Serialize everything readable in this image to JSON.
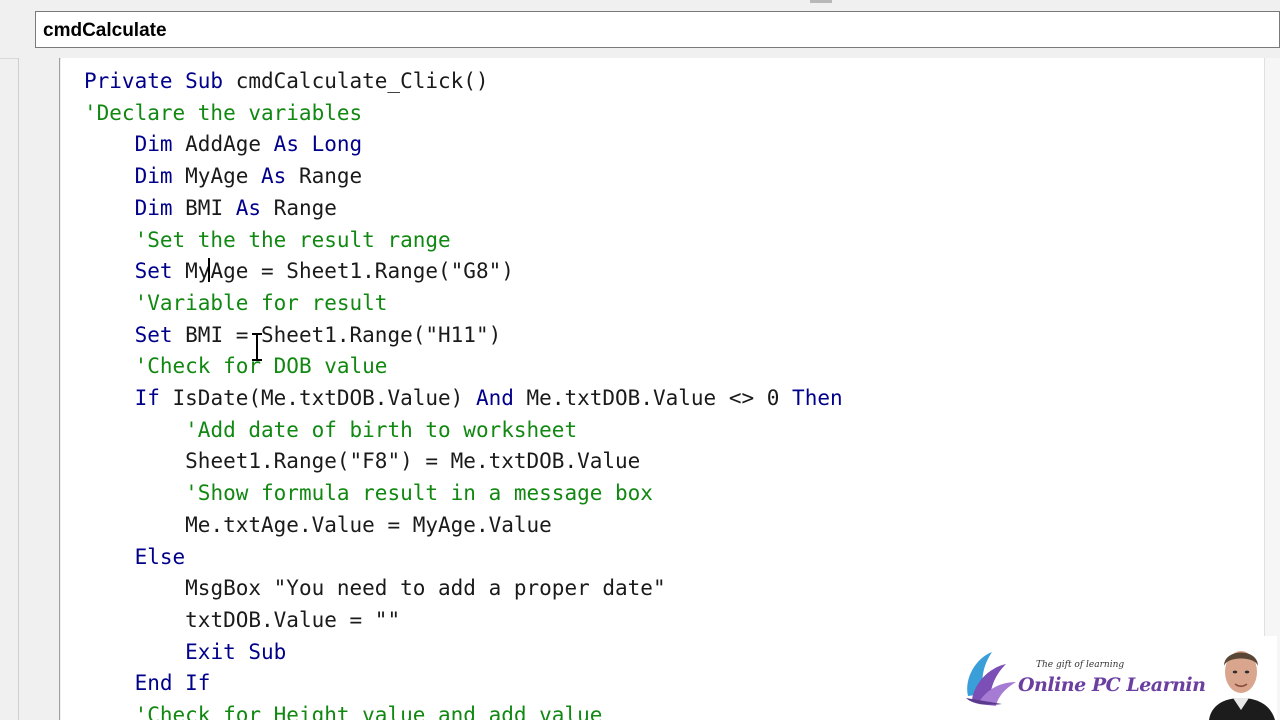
{
  "editor": {
    "object_combo_value": "cmdCalculate"
  },
  "code_lines": [
    [
      {
        "t": "Private Sub ",
        "c": "kw"
      },
      {
        "t": "cmdCalculate_Click()",
        "c": "tx"
      }
    ],
    [
      {
        "t": "'Declare the variables",
        "c": "cm"
      }
    ],
    [
      {
        "t": "    ",
        "c": "tx"
      },
      {
        "t": "Dim ",
        "c": "kw"
      },
      {
        "t": "AddAge ",
        "c": "tx"
      },
      {
        "t": "As Long",
        "c": "kw"
      }
    ],
    [
      {
        "t": "    ",
        "c": "tx"
      },
      {
        "t": "Dim ",
        "c": "kw"
      },
      {
        "t": "MyAge ",
        "c": "tx"
      },
      {
        "t": "As ",
        "c": "kw"
      },
      {
        "t": "Range",
        "c": "tx"
      }
    ],
    [
      {
        "t": "    ",
        "c": "tx"
      },
      {
        "t": "Dim ",
        "c": "kw"
      },
      {
        "t": "BMI ",
        "c": "tx"
      },
      {
        "t": "As ",
        "c": "kw"
      },
      {
        "t": "Range",
        "c": "tx"
      }
    ],
    [
      {
        "t": "    ",
        "c": "tx"
      },
      {
        "t": "'Set the the result range",
        "c": "cm"
      }
    ],
    [
      {
        "t": "    ",
        "c": "tx"
      },
      {
        "t": "Set ",
        "c": "kw"
      },
      {
        "t": "MyAge = Sheet1.Range(\"G8\")",
        "c": "tx"
      }
    ],
    [
      {
        "t": "    ",
        "c": "tx"
      },
      {
        "t": "'Variable for result",
        "c": "cm"
      }
    ],
    [
      {
        "t": "    ",
        "c": "tx"
      },
      {
        "t": "Set ",
        "c": "kw"
      },
      {
        "t": "BMI = Sheet1.Range(\"H11\")",
        "c": "tx"
      }
    ],
    [
      {
        "t": "    ",
        "c": "tx"
      },
      {
        "t": "'Check for DOB value",
        "c": "cm"
      }
    ],
    [
      {
        "t": "    ",
        "c": "tx"
      },
      {
        "t": "If ",
        "c": "kw"
      },
      {
        "t": "IsDate(Me.txtDOB.Value) ",
        "c": "tx"
      },
      {
        "t": "And ",
        "c": "kw"
      },
      {
        "t": "Me.txtDOB.Value <> 0 ",
        "c": "tx"
      },
      {
        "t": "Then",
        "c": "kw"
      }
    ],
    [
      {
        "t": "        ",
        "c": "tx"
      },
      {
        "t": "'Add date of birth to worksheet",
        "c": "cm"
      }
    ],
    [
      {
        "t": "        ",
        "c": "tx"
      },
      {
        "t": "Sheet1.Range(\"F8\") = Me.txtDOB.Value",
        "c": "tx"
      }
    ],
    [
      {
        "t": "        ",
        "c": "tx"
      },
      {
        "t": "'Show formula result in a message box",
        "c": "cm"
      }
    ],
    [
      {
        "t": "        ",
        "c": "tx"
      },
      {
        "t": "Me.txtAge.Value = MyAge.Value",
        "c": "tx"
      }
    ],
    [
      {
        "t": "    ",
        "c": "tx"
      },
      {
        "t": "Else",
        "c": "kw"
      }
    ],
    [
      {
        "t": "        ",
        "c": "tx"
      },
      {
        "t": "MsgBox \"You need to add a proper date\"",
        "c": "tx"
      }
    ],
    [
      {
        "t": "        ",
        "c": "tx"
      },
      {
        "t": "txtDOB.Value = \"\"",
        "c": "tx"
      }
    ],
    [
      {
        "t": "        ",
        "c": "tx"
      },
      {
        "t": "Exit Sub",
        "c": "kw"
      }
    ],
    [
      {
        "t": "    ",
        "c": "tx"
      },
      {
        "t": "End If",
        "c": "kw"
      }
    ],
    [
      {
        "t": "    ",
        "c": "tx"
      },
      {
        "t": "'Check for Height value and add value",
        "c": "cm"
      }
    ]
  ],
  "colors": {
    "keyword": "#00008b",
    "comment": "#118811",
    "text": "#1a1a1a"
  },
  "branding": {
    "tagline": "The gift of learning",
    "name": "Online PC Learning"
  }
}
